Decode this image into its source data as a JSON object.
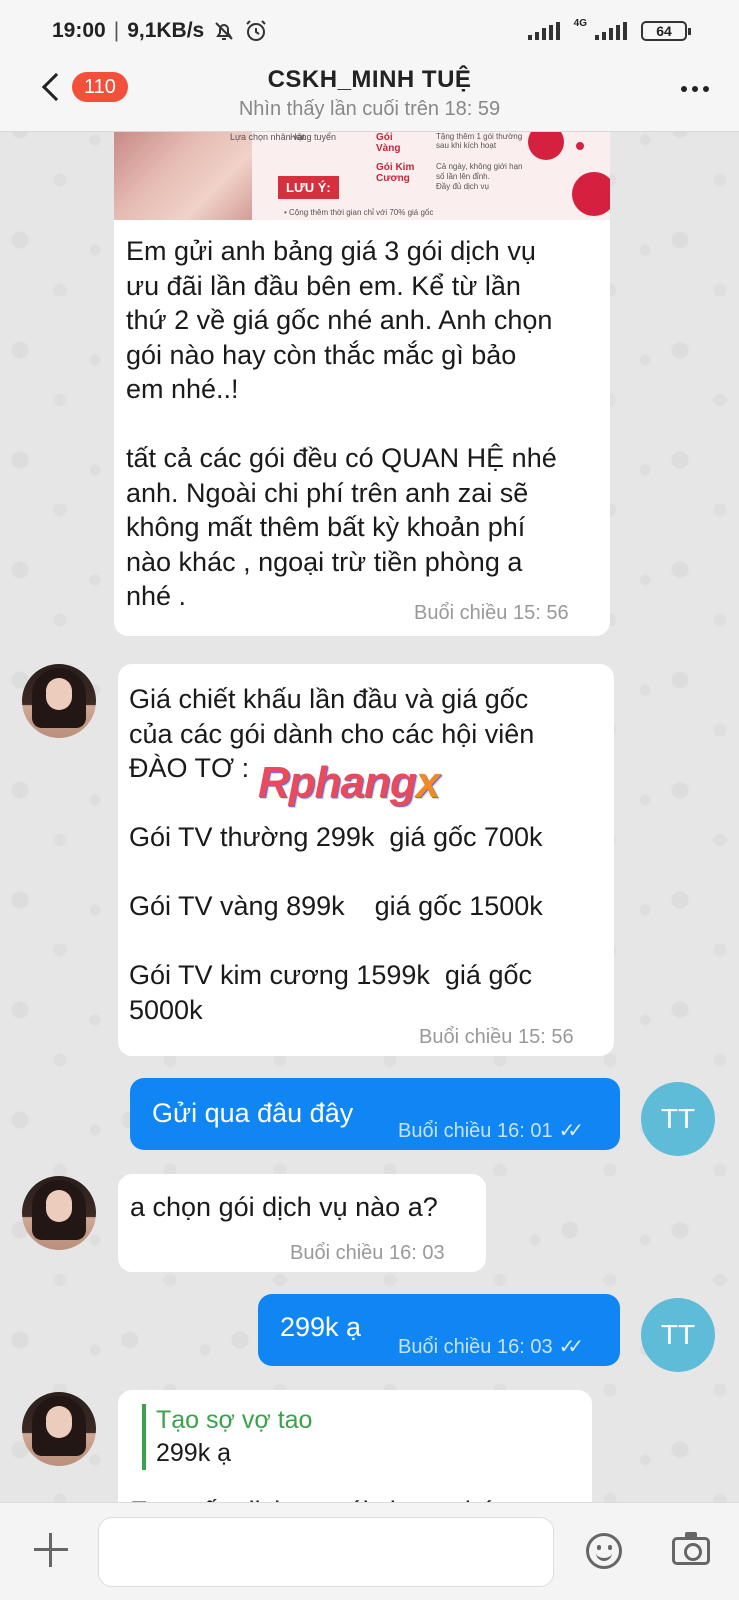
{
  "status_bar": {
    "time": "19:00",
    "separator": "|",
    "speed": "9,1KB/s",
    "network_label": "4G",
    "battery": "64"
  },
  "header": {
    "back_badge": "110",
    "title": "CSKH_MINH TUỆ",
    "subtitle": "Nhìn thấy lần cuối trên 18: 59"
  },
  "promo_image": {
    "col1": "Lựa chọn nhân vật",
    "col2": "Hàng tuyển",
    "pkg_gold": "Gói\nVàng",
    "pkg_diamond": "Gói Kim\nCương",
    "gold_note": "Tặng thêm 1 gói thường\nsau khi kích hoạt",
    "diamond_note": "Cả ngày, không giới hạn\nsố lần lên đỉnh.\nĐầy đủ dịch vụ",
    "note_label": "LƯU Ý:",
    "footer": "• Cộng thêm thời gian chỉ với 70% giá gốc"
  },
  "messages": [
    {
      "text": "Em gửi anh bảng giá 3 gói dịch vụ\nưu đãi lần đầu bên em. Kể từ lần\nthứ 2 về giá gốc nhé anh. Anh chọn\ngói nào hay còn thắc mắc gì bảo\nem nhé..!\n\ntất cả các gói đều có QUAN HỆ nhé\nanh. Ngoài chi phí trên anh zai sẽ\nkhông mất thêm bất kỳ khoản phí\nnào khác , ngoại trừ tiền phòng a\nnhé .",
      "time": "Buổi chiều  15: 56"
    },
    {
      "text": "Giá chiết khấu lần đầu và giá gốc\ncủa các gói dành cho các hội viên\nĐÀO TƠ :\n\nGói TV thường 299k  giá gốc 700k\n\nGói TV vàng 899k    giá gốc 1500k\n\nGói TV kim cương 1599k  giá gốc\n5000k",
      "time": "Buổi chiều  15: 56"
    },
    {
      "text": "Gửi qua đâu đây",
      "time": "Buổi chiều  16: 01"
    },
    {
      "text": "a chọn gói dịch vụ nào a?",
      "time": "Buổi chiều  16: 03"
    },
    {
      "text": "299k ạ",
      "time": "Buổi chiều  16: 03"
    },
    {
      "quote_author": "Tạo sợ vợ tao",
      "quote_text": "299k ạ",
      "text": "E tư vấn dịch vụ gói cho a nhé :"
    }
  ],
  "my_avatar_initials": "TT",
  "watermark": {
    "main": "Rphang",
    "accent": "x"
  },
  "input": {
    "placeholder": ""
  },
  "icons": {
    "ticks": "✓✓"
  },
  "colors": {
    "my_bubble": "#0f86f4",
    "badge": "#f2503a",
    "my_avatar": "#5fbcd8",
    "quote_accent": "#3aa24a"
  }
}
